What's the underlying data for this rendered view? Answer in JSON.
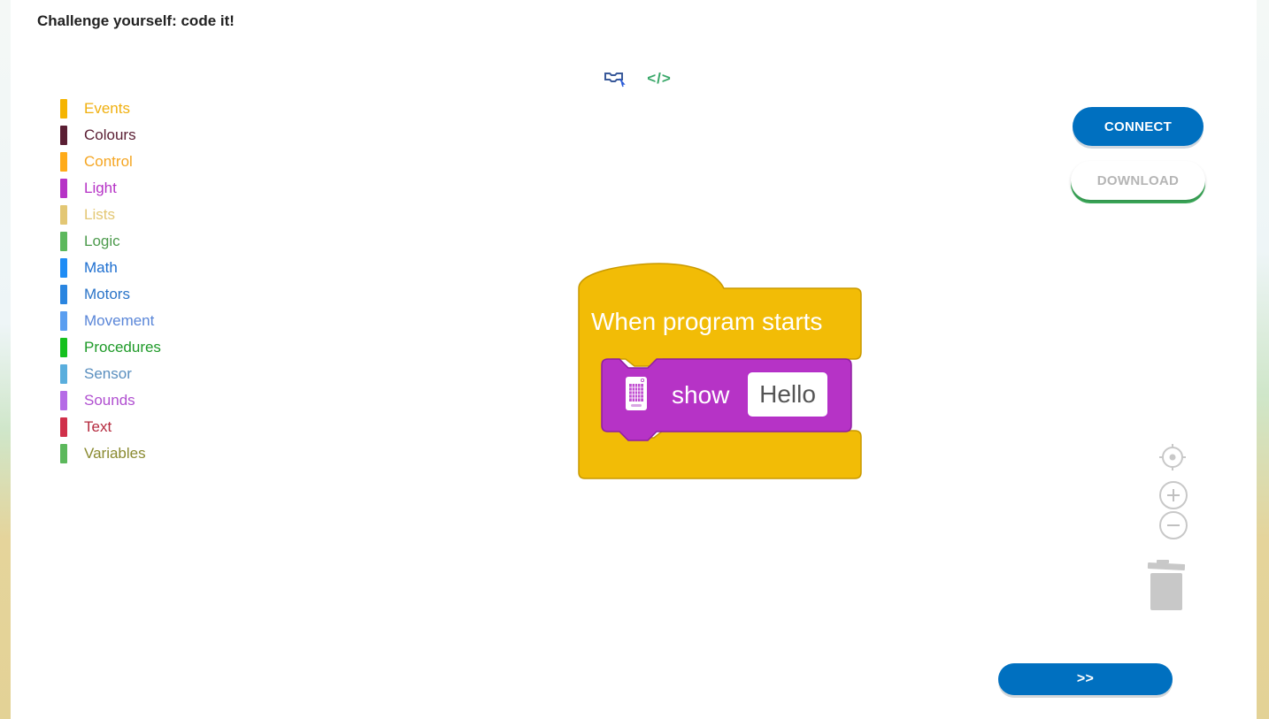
{
  "page": {
    "title": "Challenge yourself: code it!"
  },
  "view_toggle": {
    "blocks_icon": "blocks-view-icon",
    "code_icon": "code-view-icon",
    "code_glyph": "</>"
  },
  "categories": [
    {
      "label": "Events",
      "color": "#f5b400",
      "text_color": "#f0b010"
    },
    {
      "label": "Colours",
      "color": "#5a1e33",
      "text_color": "#5a1e33"
    },
    {
      "label": "Control",
      "color": "#ffab19",
      "text_color": "#f5a623"
    },
    {
      "label": "Light",
      "color": "#b633c6",
      "text_color": "#b633c6"
    },
    {
      "label": "Lists",
      "color": "#e3c774",
      "text_color": "#e3c774"
    },
    {
      "label": "Logic",
      "color": "#5cb85c",
      "text_color": "#4c9a4c"
    },
    {
      "label": "Math",
      "color": "#1e8cf5",
      "text_color": "#1e6fd0"
    },
    {
      "label": "Motors",
      "color": "#2a85e0",
      "text_color": "#2a74c8"
    },
    {
      "label": "Movement",
      "color": "#5a9ef0",
      "text_color": "#5a86d8"
    },
    {
      "label": "Procedures",
      "color": "#15c01e",
      "text_color": "#1e9a28"
    },
    {
      "label": "Sensor",
      "color": "#5aaedd",
      "text_color": "#5a8fbf"
    },
    {
      "label": "Sounds",
      "color": "#b56be6",
      "text_color": "#b04fd0"
    },
    {
      "label": "Text",
      "color": "#d0304a",
      "text_color": "#b52a3e"
    },
    {
      "label": "Variables",
      "color": "#5cb85c",
      "text_color": "#8a8a30"
    }
  ],
  "actions": {
    "connect": "CONNECT",
    "download": "DOWNLOAD",
    "next": ">>"
  },
  "workspace": {
    "hat_block": {
      "label": "When program starts",
      "color": "#f2bc06"
    },
    "show_block": {
      "label": "show",
      "value": "Hello",
      "color": "#b633c6"
    }
  },
  "controls": {
    "recenter_icon": "recenter-icon",
    "zoom_in_icon": "zoom-in-icon",
    "zoom_out_icon": "zoom-out-icon",
    "trash_icon": "trash-icon"
  }
}
